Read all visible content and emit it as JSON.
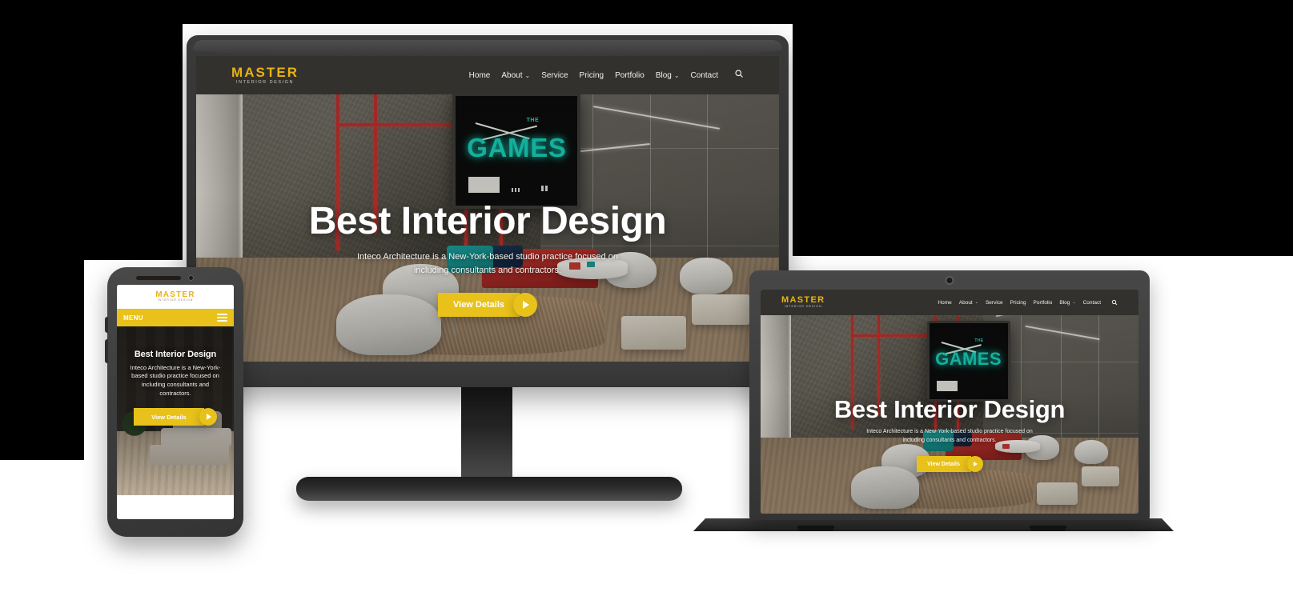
{
  "site": {
    "logo": {
      "main": "MASTER",
      "sub": "INTERIOR DESIGN"
    },
    "nav": [
      {
        "label": "Home",
        "has_caret": false
      },
      {
        "label": "About",
        "has_caret": true
      },
      {
        "label": "Service",
        "has_caret": false
      },
      {
        "label": "Pricing",
        "has_caret": false
      },
      {
        "label": "Portfolio",
        "has_caret": false
      },
      {
        "label": "Blog",
        "has_caret": true
      },
      {
        "label": "Contact",
        "has_caret": false
      }
    ],
    "search_icon": "search-icon",
    "caret_glyph": "⌄",
    "search_glyph": "⚲",
    "hero": {
      "title": "Best Interior Design",
      "subtitle": "Inteco Architecture is a New-York-based studio practice focused on including consultants and contractors.",
      "subtitle_line1": "Inteco Architecture is a New-York-based studio practice focused on",
      "subtitle_line2": "including consultants and contractors.",
      "cta_label": "View Details",
      "play_icon": "play-icon"
    },
    "hero_image": {
      "description": "Modern lounge interior with concrete wall, red neon tubes, wall-mounted TV, white chairs, red sofa with teal cushions and round table on a rug",
      "tv_sign_small": "THE",
      "tv_sign_main": "GAMES"
    }
  },
  "mobile": {
    "menu_label": "MENU",
    "menu_icon": "hamburger-icon",
    "hero": {
      "title": "Best Interior Design",
      "subtitle_line1": "Inteco Architecture is a New-York-",
      "subtitle_line2": "based studio practice focused on",
      "subtitle_line3": "including consultants and",
      "subtitle_line4": "contractors.",
      "cta_label": "View Details"
    },
    "hero_image": {
      "description": "Dark bedroom interior with bed, pillows, plant and hanging lamp"
    }
  },
  "devices": [
    {
      "name": "desktop-monitor"
    },
    {
      "name": "mobile-phone"
    },
    {
      "name": "laptop"
    }
  ],
  "colors": {
    "accent_yellow": "#e8c21a",
    "logo_yellow": "#e8b312",
    "header_dark": "#32312e",
    "device_gray": "#3c3c3c",
    "neon_teal": "#17c9b4",
    "neon_red": "#b8302c",
    "canvas_white": "#ffffff",
    "background_black": "#000000"
  }
}
